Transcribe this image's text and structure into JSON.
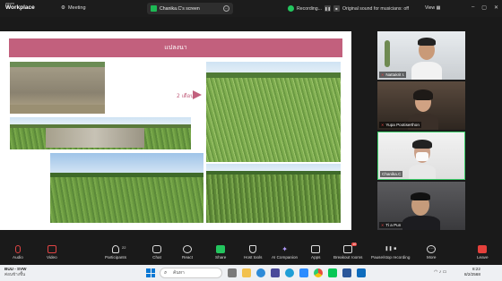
{
  "app": {
    "brand_top": "zoom",
    "brand_main": "Workplace"
  },
  "topbar": {
    "meeting_label": "Meeting",
    "share_chip_label": "Chanika.C's screen",
    "recording_label": "Recording...",
    "original_sound_label": "Original sound for musicians: off",
    "view_label": "View"
  },
  "slide": {
    "title": "แปลงนา",
    "arrow_label": "2 เดือน"
  },
  "participants": [
    {
      "name": "Nattakrit I."
    },
    {
      "name": "Yupa Pootiserthon"
    },
    {
      "name": "Chanika.C"
    },
    {
      "name": "Ti a Pun"
    }
  ],
  "toolbar": {
    "audio": "Audio",
    "video": "Video",
    "participants": "Participants",
    "participants_count": "22",
    "chat": "Chat",
    "react": "React",
    "share": "Share",
    "host_tools": "Host tools",
    "ai_companion": "AI Companion",
    "apps": "Apps",
    "breakout_rooms": "Breakout rooms",
    "breakout_badge": "10",
    "pause_stop_recording": "Pause/stop recording",
    "more": "More",
    "leave": "Leave"
  },
  "taskbar": {
    "weather_temp": "BUU - SVW",
    "weather_desc": "ค่อนข้างชื้น",
    "search_placeholder": "ค้นหา",
    "time": "8:22",
    "date": "8/2/2568"
  },
  "colors": {
    "accent_green": "#3fd16c",
    "slide_title": "#c2607d",
    "leave_red": "#e5403b"
  }
}
